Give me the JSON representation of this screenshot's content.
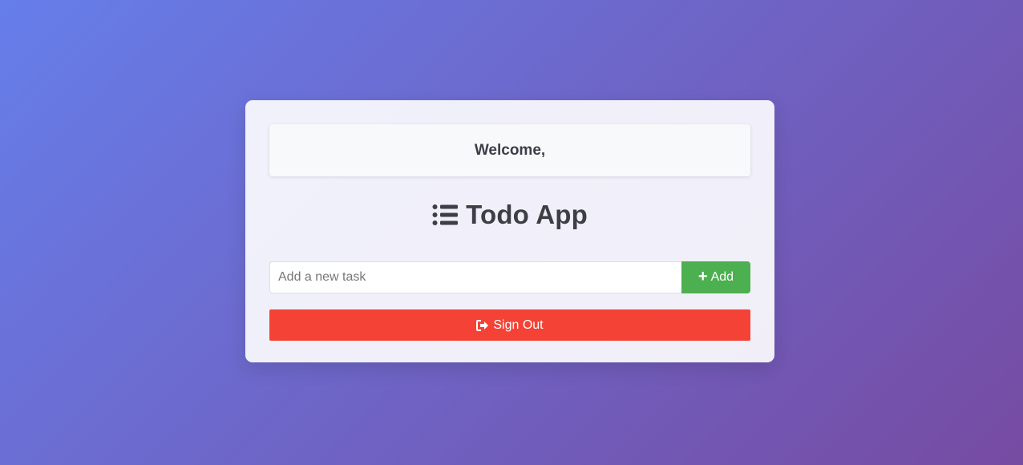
{
  "header": {
    "welcome_text": "Welcome,"
  },
  "app": {
    "title": "Todo App",
    "title_icon": "list-icon"
  },
  "task_form": {
    "input_value": "",
    "input_placeholder": "Add a new task",
    "add_label": "Add",
    "add_icon": "plus-icon",
    "add_color": "#4caf50"
  },
  "actions": {
    "signout_label": "Sign Out",
    "signout_icon": "sign-out-icon",
    "signout_color": "#f44336"
  },
  "theme": {
    "background_start": "#667eea",
    "background_end": "#764ba2"
  }
}
